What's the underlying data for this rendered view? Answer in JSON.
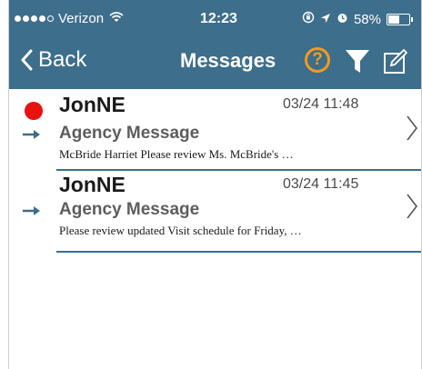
{
  "status_bar": {
    "carrier": "Verizon",
    "time": "12:23",
    "battery_percent": "58%",
    "battery_level": 0.58,
    "icons": [
      "signal-dots-icon",
      "wifi-icon",
      "lock-rotation-icon",
      "location-arrow-icon",
      "alarm-icon",
      "battery-icon"
    ]
  },
  "nav": {
    "back_label": "Back",
    "title": "Messages",
    "help_label": "?",
    "icons": [
      "chevron-left-icon",
      "help-icon",
      "filter-icon",
      "compose-icon"
    ]
  },
  "colors": {
    "header_bg": "#3d6e8b",
    "help_orange": "#f39a1e",
    "unread_red": "#e8120e",
    "divider": "#3d6e8b"
  },
  "messages": [
    {
      "sender": "JonNE",
      "datetime": "03/24 11:48",
      "subject": "Agency Message",
      "preview": "McBride Harriet Please review Ms. McBride's …",
      "unread": true
    },
    {
      "sender": "JonNE",
      "datetime": "03/24 11:45",
      "subject": "Agency Message",
      "preview": "Please review updated Visit schedule for Friday, …",
      "unread": false
    }
  ]
}
